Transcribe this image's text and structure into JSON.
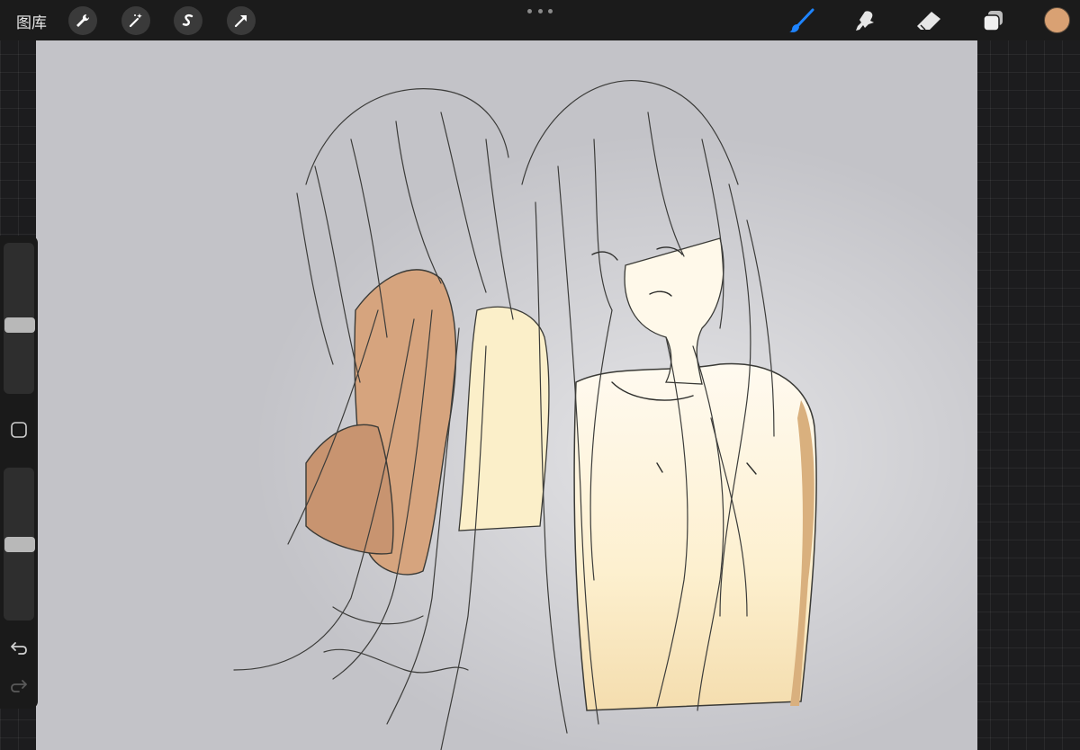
{
  "toolbar": {
    "gallery_label": "图库",
    "left_tools": [
      "wrench-icon",
      "magic-wand-icon",
      "selection-s-icon",
      "transform-arrow-icon"
    ],
    "right_tools": [
      "brush-icon",
      "smudge-icon",
      "eraser-icon",
      "layers-icon"
    ],
    "active_tool": "brush-icon",
    "accent_color": "#1e84ff",
    "current_color": "#d9a173"
  },
  "sidebar": {
    "brush_size": 0.55,
    "brush_opacity": 0.5,
    "icons": [
      "modify-square-icon",
      "undo-icon",
      "redo-icon"
    ]
  },
  "canvas": {
    "background": "#c3c3c8",
    "skin_light": "#fbefcf",
    "skin_shadow": "#d6a27a"
  }
}
